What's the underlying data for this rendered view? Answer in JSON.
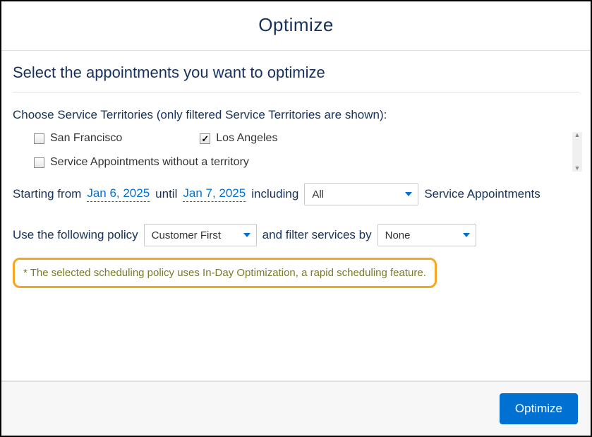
{
  "modal": {
    "title": "Optimize"
  },
  "section": {
    "title": "Select the appointments you want to optimize"
  },
  "territories": {
    "label": "Choose Service Territories (only filtered Service Territories are shown):",
    "items": [
      {
        "label": "San Francisco",
        "checked": false
      },
      {
        "label": "Los Angeles",
        "checked": true
      },
      {
        "label": "Service Appointments without a territory",
        "checked": false
      }
    ]
  },
  "dateRow": {
    "startingFrom": "Starting from",
    "startDate": "Jan 6, 2025",
    "until": "until",
    "endDate": "Jan 7, 2025",
    "including": "including",
    "includeValue": "All",
    "saLabel": "Service Appointments"
  },
  "policyRow": {
    "prefix": "Use the following policy",
    "policyValue": "Customer First",
    "filterPrefix": "and filter services by",
    "filterValue": "None"
  },
  "info": {
    "message": "* The selected scheduling policy uses In-Day Optimization, a rapid scheduling feature."
  },
  "footer": {
    "optimize": "Optimize"
  }
}
